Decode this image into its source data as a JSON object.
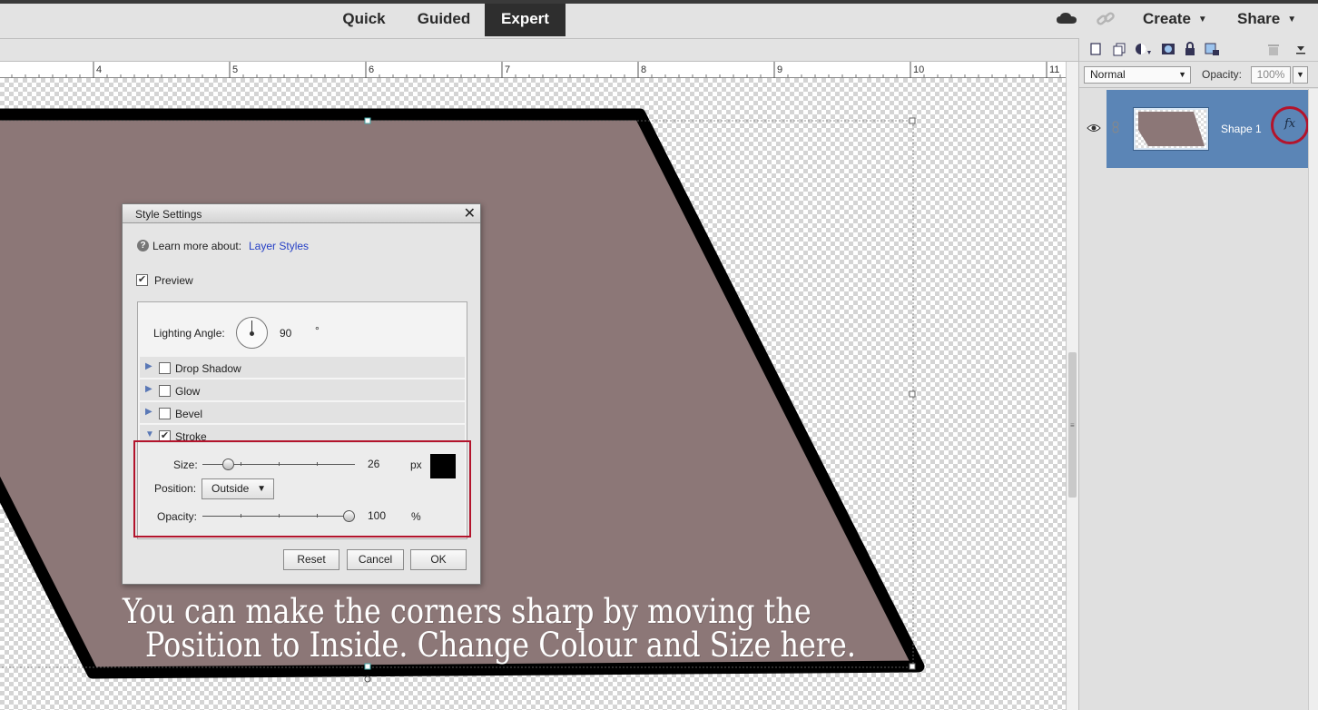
{
  "modes": {
    "quick": "Quick",
    "guided": "Guided",
    "expert": "Expert"
  },
  "top_menu": {
    "create": "Create",
    "share": "Share"
  },
  "ruler": {
    "ticks": [
      "4",
      "5",
      "6",
      "7",
      "8",
      "9",
      "10",
      "11"
    ]
  },
  "layers_panel": {
    "blend_mode": "Normal",
    "opacity_label": "Opacity:",
    "opacity_value": "100%",
    "layer_name": "Shape 1",
    "fx_label": "fx"
  },
  "dialog": {
    "title": "Style Settings",
    "close": "✕",
    "help_text": "Learn more about:",
    "help_link": "Layer Styles",
    "preview_label": "Preview",
    "preview_checked": true,
    "lighting_angle_label": "Lighting Angle:",
    "lighting_angle_value": "90",
    "lighting_angle_unit": "°",
    "styles": [
      {
        "label": "Drop Shadow",
        "checked": false,
        "expanded": false
      },
      {
        "label": "Glow",
        "checked": false,
        "expanded": false
      },
      {
        "label": "Bevel",
        "checked": false,
        "expanded": false
      },
      {
        "label": "Stroke",
        "checked": true,
        "expanded": true
      }
    ],
    "stroke": {
      "size_label": "Size:",
      "size_value": "26",
      "size_unit": "px",
      "size_level": 0.14,
      "color": "#000000",
      "position_label": "Position:",
      "position_value": "Outside",
      "opacity_label": "Opacity:",
      "opacity_value": "100",
      "opacity_unit": "%",
      "opacity_level": 1.0
    },
    "buttons": {
      "reset": "Reset",
      "cancel": "Cancel",
      "ok": "OK"
    }
  },
  "caption": {
    "line1": "You can make the corners sharp by moving the",
    "line2": "Position to Inside. Change Colour and Size here."
  },
  "colors": {
    "shape_fill": "#8c7777",
    "stroke": "#000000",
    "accent_red": "#b3142c",
    "layer_selected": "#5b85b6"
  }
}
